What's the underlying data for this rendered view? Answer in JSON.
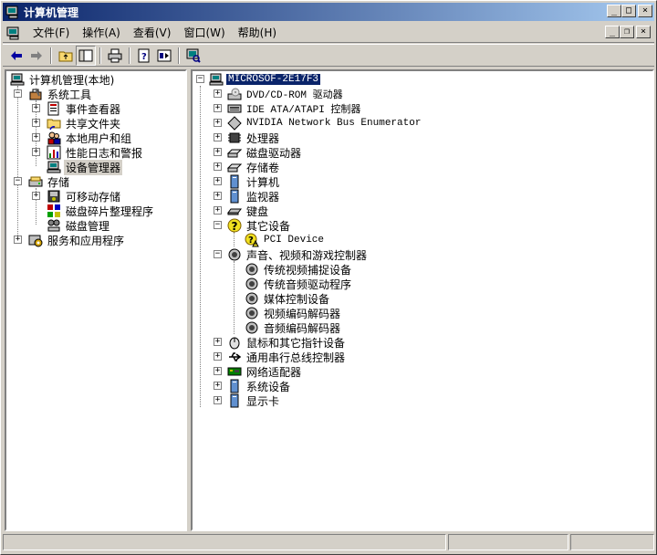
{
  "window": {
    "title": "计算机管理"
  },
  "menu": {
    "items": [
      {
        "label": "文件(F)",
        "name": "menu-file"
      },
      {
        "label": "操作(A)",
        "name": "menu-action"
      },
      {
        "label": "查看(V)",
        "name": "menu-view"
      },
      {
        "label": "窗口(W)",
        "name": "menu-window"
      },
      {
        "label": "帮助(H)",
        "name": "menu-help"
      }
    ]
  },
  "left_tree": {
    "root": "计算机管理(本地)",
    "items": [
      {
        "label": "系统工具"
      },
      {
        "label": "事件查看器"
      },
      {
        "label": "共享文件夹"
      },
      {
        "label": "本地用户和组"
      },
      {
        "label": "性能日志和警报"
      },
      {
        "label": "设备管理器"
      },
      {
        "label": "存储"
      },
      {
        "label": "可移动存储"
      },
      {
        "label": "磁盘碎片整理程序"
      },
      {
        "label": "磁盘管理"
      },
      {
        "label": "服务和应用程序"
      }
    ]
  },
  "right_tree": {
    "root": "MICROSOF-2E17F3",
    "items": [
      {
        "label": "DVD/CD-ROM 驱动器"
      },
      {
        "label": "IDE ATA/ATAPI 控制器"
      },
      {
        "label": "NVIDIA Network Bus Enumerator"
      },
      {
        "label": "处理器"
      },
      {
        "label": "磁盘驱动器"
      },
      {
        "label": "存储卷"
      },
      {
        "label": "计算机"
      },
      {
        "label": "监视器"
      },
      {
        "label": "键盘"
      },
      {
        "label": "其它设备"
      },
      {
        "label": "PCI Device"
      },
      {
        "label": "声音、视频和游戏控制器"
      },
      {
        "label": "传统视频捕捉设备"
      },
      {
        "label": "传统音频驱动程序"
      },
      {
        "label": "媒体控制设备"
      },
      {
        "label": "视频编码解码器"
      },
      {
        "label": "音频编码解码器"
      },
      {
        "label": "鼠标和其它指针设备"
      },
      {
        "label": "通用串行总线控制器"
      },
      {
        "label": "网络适配器"
      },
      {
        "label": "系统设备"
      },
      {
        "label": "显示卡"
      }
    ]
  },
  "icons": {
    "titlebar": "computer-management-icon",
    "back": "back-arrow-icon",
    "forward": "forward-arrow-icon",
    "up": "up-folder-icon",
    "show_tree": "show-hide-tree-icon",
    "print": "print-icon",
    "help": "help-icon",
    "properties": "properties-icon",
    "scan": "scan-hardware-icon"
  },
  "colors": {
    "title_start": "#0a246a",
    "title_end": "#a6caf0",
    "face": "#d4d0c8",
    "selection": "#0a246a"
  }
}
